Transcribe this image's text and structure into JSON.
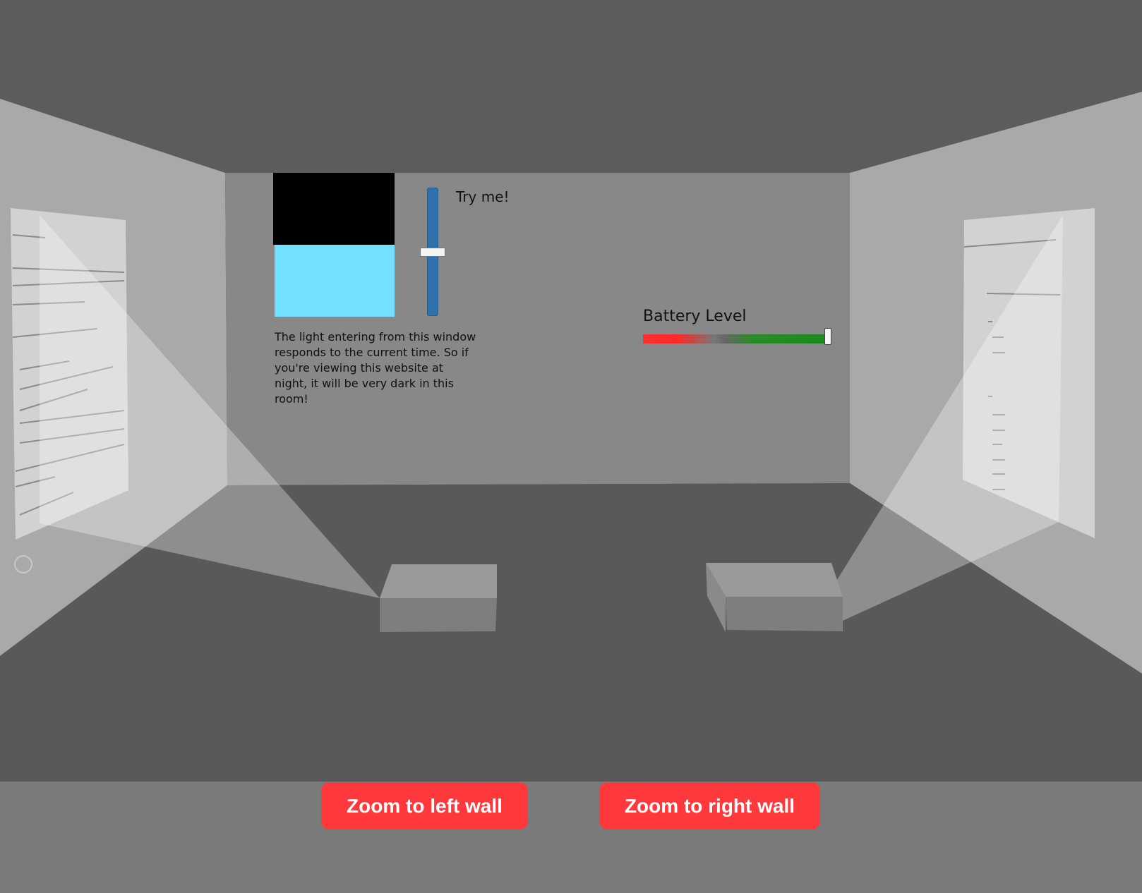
{
  "window_demo": {
    "slider_label": "Try me!",
    "caption": "The light entering from this window responds to the current time. So if you're viewing this website at night, it will be very dark in this room!",
    "time_level": 0.5,
    "sky_color": "#73e0ff"
  },
  "battery": {
    "label": "Battery Level",
    "level": 1.0
  },
  "controls": {
    "zoom_left_label": "Zoom to left wall",
    "zoom_right_label": "Zoom to right wall",
    "button_color": "#ff383c"
  }
}
